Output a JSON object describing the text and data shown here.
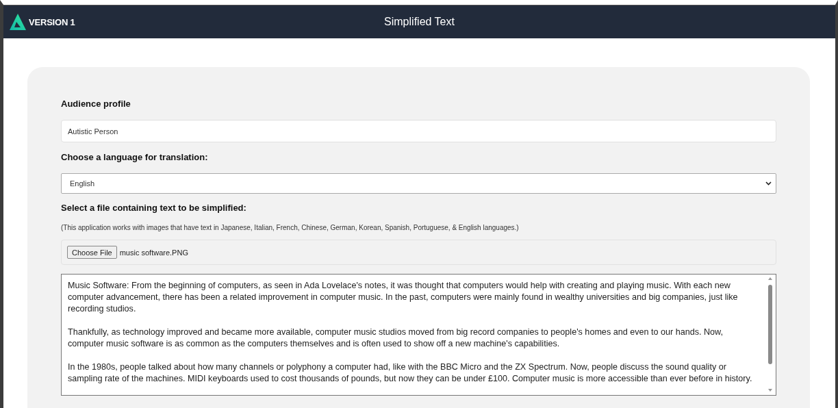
{
  "header": {
    "brand": "VERSION 1",
    "title": "Simplified Text"
  },
  "audience": {
    "label": "Audience profile",
    "value": "Autistic Person"
  },
  "language": {
    "label": "Choose a language for translation:",
    "value": "English"
  },
  "file": {
    "label": "Select a file containing text to be simplified:",
    "note": "(This application works with images that have text in Japanese, Italian, French, Chinese, German, Korean, Spanish, Portuguese, & English languages.)",
    "button": "Choose File",
    "filename": "music software.PNG"
  },
  "output": {
    "paragraphs": [
      "Music Software: From the beginning of computers, as seen in Ada Lovelace's notes, it was thought that computers would help with creating and playing music. With each new computer advancement, there has been a related improvement in computer music. In the past, computers were mainly found in wealthy universities and big companies, just like recording studios.",
      "Thankfully, as technology improved and became more available, computer music studios moved from big record companies to people's homes and even to our hands. Now, computer music software is as common as the computers themselves and is often used to show off a new machine's capabilities.",
      "In the 1980s, people talked about how many channels or polyphony a computer had, like with the BBC Micro and the ZX Spectrum. Now, people discuss the sound quality or sampling rate of the machines. MIDI keyboards used to cost thousands of pounds, but now they can be under £100. Computer music is more accessible than ever before in history."
    ]
  }
}
